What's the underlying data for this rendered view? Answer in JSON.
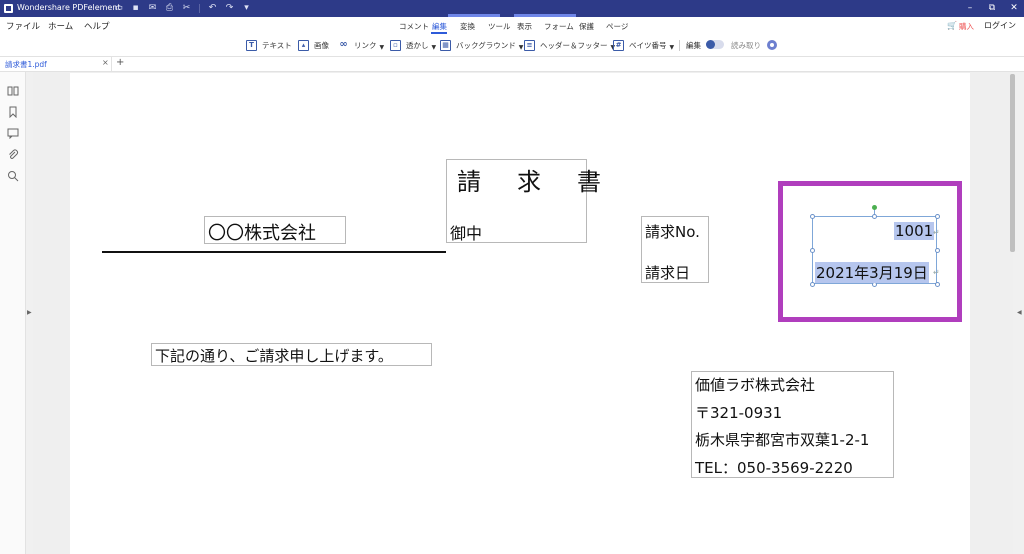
{
  "titlebar": {
    "app_title": "Wondershare PDFelement",
    "win_minimize": "–",
    "win_restore": "⧉",
    "win_close": "✕"
  },
  "menubar": {
    "menus": [
      "ファイル",
      "ホーム",
      "ヘルプ"
    ],
    "tabs": [
      "コメント",
      "編集",
      "変換",
      "ツール",
      "表示",
      "フォーム",
      "保護",
      "ページ"
    ],
    "active_tab": "編集",
    "purchase": "購入",
    "login": "ログイン"
  },
  "toolbar": {
    "tools": [
      {
        "label": "テキスト",
        "icon": "text-icon"
      },
      {
        "label": "画像",
        "icon": "image-icon"
      },
      {
        "label": "リンク",
        "icon": "link-icon"
      },
      {
        "label": "透かし",
        "icon": "watermark-icon"
      },
      {
        "label": "バックグラウンド",
        "icon": "background-icon"
      },
      {
        "label": "ヘッダー＆フッター",
        "icon": "header-footer-icon"
      },
      {
        "label": "ベイツ番号",
        "icon": "bates-icon"
      }
    ],
    "edit_label": "編集",
    "read_label": "読み取り"
  },
  "doctabs": {
    "name": "請求書1.pdf",
    "close": "×",
    "add": "+"
  },
  "document": {
    "title": "請　求　書",
    "recipient": "〇〇株式会社",
    "honorific": "御中",
    "invoice_no_label": "請求No.",
    "invoice_date_label": "請求日",
    "invoice_no_value": "1001",
    "invoice_date_value": "2021年3月19日",
    "intro": "下記の通り、ご請求申し上げます。",
    "issuer": {
      "company": "価値ラボ株式会社",
      "postal": "〒321-0931",
      "address": "栃木県宇都宮市双葉1-2-1",
      "tel": "TEL：050-3569-2220"
    }
  },
  "colors": {
    "titlebar": "#2d3a88",
    "accent": "#2e5bd9",
    "highlight_frame": "#b03ebd",
    "selection_fill": "#b6c6ee"
  }
}
